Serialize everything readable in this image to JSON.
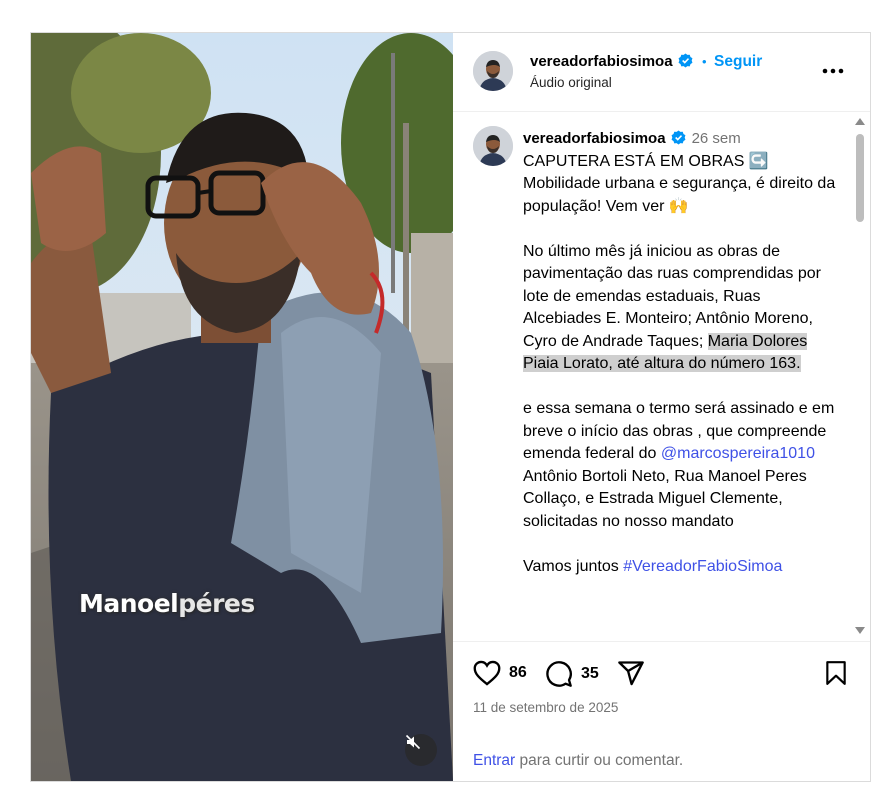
{
  "media": {
    "overlay_caption_part1": "Manoel",
    "overlay_caption_part2": "péres"
  },
  "header": {
    "username": "vereadorfabiosimoa",
    "separator": "•",
    "follow_label": "Seguir",
    "audio_label": "Áudio original",
    "more_label": "•••"
  },
  "post": {
    "username": "vereadorfabiosimoa",
    "time_ago": "26 sem",
    "line1": "CAPUTERA ESTÁ EM OBRAS ↪️",
    "line2": "Mobilidade urbana e segurança, é direito da população! Vem ver 🙌",
    "para1_before": "No último mês já iniciou as obras de pavimentação das ruas comprendidas por lote de emendas estaduais, Ruas Alcebiades E. Monteiro;  Antônio Moreno, Cyro de Andrade Taques; ",
    "para1_highlight": "Maria Dolores Piaia Lorato, até altura do número 163.",
    "para2_before": "e essa semana o termo será assinado e em breve o início das obras , que compreende emenda federal do ",
    "mention": "@marcospereira1010",
    "para2_after": " Antônio Bortoli Neto, Rua Manoel Peres Collaço, e Estrada Miguel Clemente, solicitadas no nosso mandato",
    "closing": "Vamos juntos ",
    "hashtag": "#VereadorFabioSimoa"
  },
  "actions": {
    "likes": "86",
    "comments": "35",
    "date": "11 de setembro de 2025",
    "login_link": "Entrar",
    "login_rest": " para curtir ou comentar."
  },
  "colors": {
    "accent": "#0095f6",
    "link": "#3f51e6",
    "muted": "#737373",
    "verified": "#0095f6"
  }
}
